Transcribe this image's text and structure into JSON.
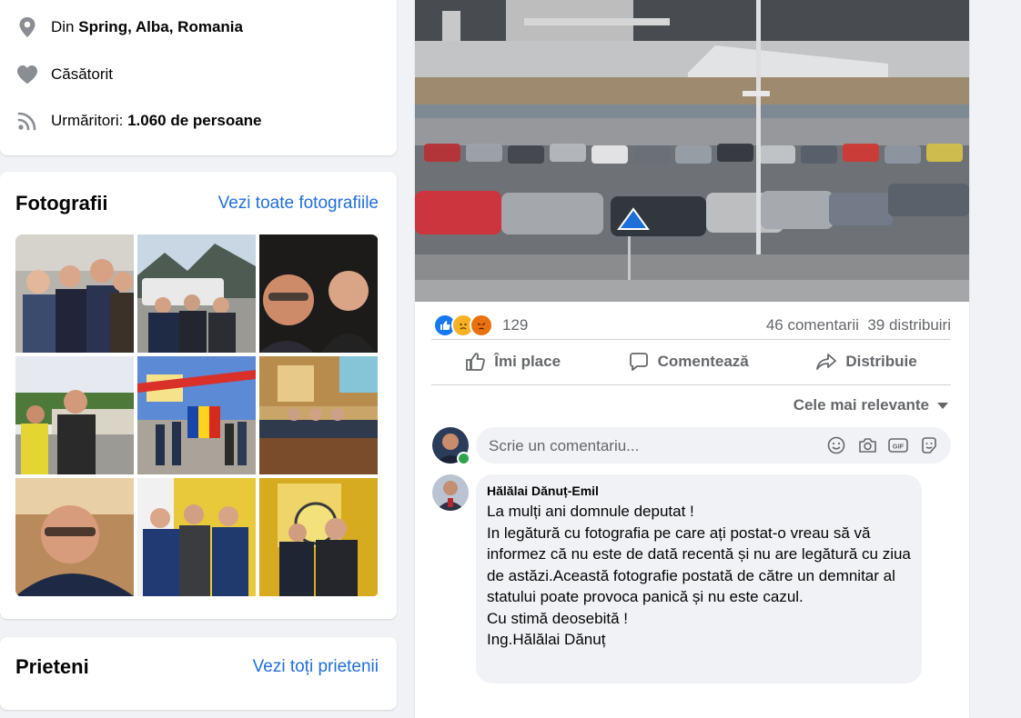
{
  "intro": {
    "location_prefix": "Din",
    "location_value": "Spring, Alba, Romania",
    "relationship": "Căsătorit",
    "followers_prefix": "Urmăritori:",
    "followers_value": "1.060 de persoane"
  },
  "photos": {
    "title": "Fotografii",
    "see_all": "Vezi toate fotografiile"
  },
  "friends": {
    "title": "Prieteni",
    "see_all": "Vezi toți prietenii"
  },
  "post": {
    "reaction_count": "129",
    "comments_count": "46 comentarii",
    "shares_count": "39 distribuiri",
    "like_label": "Îmi place",
    "comment_label": "Comentează",
    "share_label": "Distribuie",
    "sort_label": "Cele mai relevante",
    "comment_placeholder": "Scrie un comentariu..."
  },
  "comment": {
    "author": "Hălălai Dănuț-Emil",
    "lines": [
      "La mulți ani domnule deputat !",
      "In legătură cu fotografia pe care ați postat-o vreau să vă informez că nu este de dată recentă și nu are legătură cu ziua de astăzi.Această fotografie postată de către un demnitar al statului poate provoca panică și nu este cazul.",
      "Cu stimă deosebită !",
      "Ing.Hălălai Dănuț"
    ]
  },
  "colors": {
    "link": "#216fdb",
    "secondary_text": "#65676b",
    "like_blue": "#1877f2",
    "sad_yellow": "#f7b125",
    "angry_orange": "#e9710f",
    "online_green": "#31a24c"
  }
}
